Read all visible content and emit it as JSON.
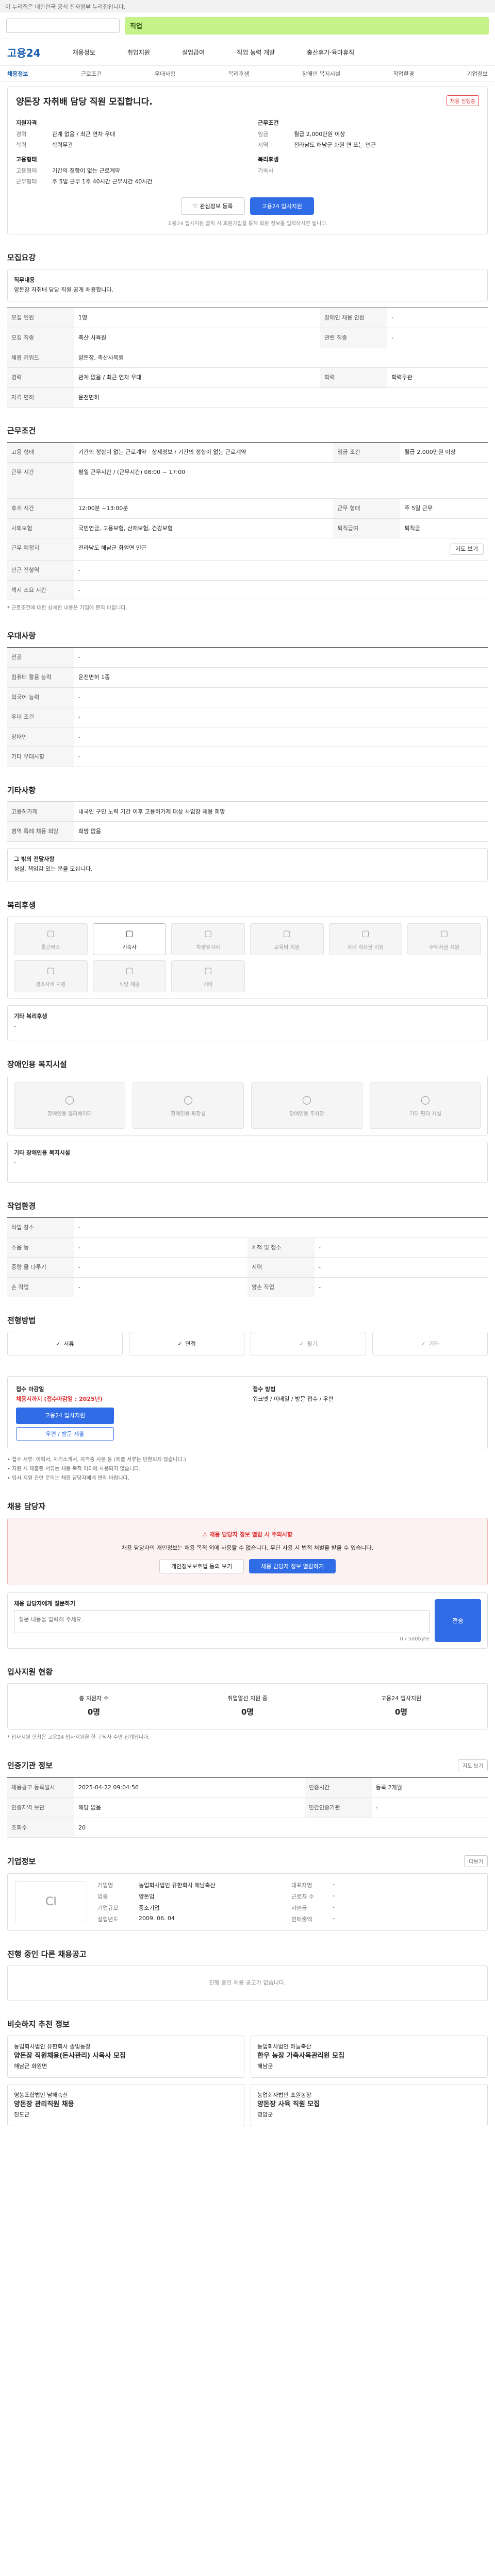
{
  "topbar": "이 누리집은 대한민국 공식 전자정부 누리집입니다.",
  "banner": "직업",
  "logo": "고용24",
  "gnb": [
    "채용정보",
    "취업지원",
    "실업급여",
    "직업 능력 개발",
    "출산휴가·육아휴직"
  ],
  "tabs": [
    "채용정보",
    "근로조건",
    "우대사항",
    "복리후생",
    "장애인 복지시설",
    "작업환경",
    "기업정보"
  ],
  "job": {
    "title": "양돈장 자취배 담당 직원 모집합니다.",
    "status": "채용 진행중",
    "left_head": "지원자격",
    "left": [
      [
        "경력",
        "관계 없음 / 최근 연차 우대"
      ],
      [
        "학력",
        "학력무관"
      ]
    ],
    "right_head": "근무조건",
    "right": [
      [
        "임금",
        "월급 2,000만원 이상"
      ],
      [
        "지역",
        "전라남도 해남군 화원 면 또는 인근"
      ]
    ],
    "left2_head": "고용형태",
    "left2": [
      [
        "고용형태",
        "기간의 정함이 없는 근로계약"
      ],
      [
        "근무형태",
        "주 5일 근무 1주 40시간 근무시간 40시간"
      ]
    ],
    "right2_head": "복리후생",
    "right2": [
      [
        "기숙사",
        "기숙사"
      ]
    ],
    "btn_save": "관심정보 등록",
    "btn_apply": "고용24 입사지원",
    "note": "고용24 입사지원 클릭 시 회원가입을 통해 회원 정보를 입력하시면 됩니다."
  },
  "recruit": {
    "heading": "모집요강",
    "task_head": "직무내용",
    "task": "양돈장 자취배 담당 직원 공개 채용합니다.",
    "rows": [
      [
        "모집 인원",
        "1명",
        "장애인 채용 인원",
        "-"
      ],
      [
        "모집 직종",
        "축산 사육원",
        "관련 직종",
        "-"
      ],
      [
        "채용 키워드",
        "양돈장, 축산사육원",
        "",
        ""
      ],
      [
        "경력",
        "관계 없음 / 최근 연차 우대",
        "학력",
        "학력무관"
      ],
      [
        "자격 면허",
        "운전면허",
        "",
        ""
      ]
    ]
  },
  "conditions": {
    "heading": "근무조건",
    "rows": [
      [
        "고용 형태",
        "기간의 정함이 없는 근로계약 · 상세정보 / 기간의 정함이 없는 근로계약",
        "임금 조건",
        "월급 2,000만원 이상"
      ],
      [
        "근무 시간",
        "평일 근무시간 / (근무시간) 08:00 ~ 17:00",
        "",
        ""
      ],
      [
        "휴게 시간",
        "12:00분 ~13:00분",
        "근무 형태",
        "주 5일 근무"
      ],
      [
        "사회보험",
        "국민연금, 고용보험, 산재보험, 건강보험",
        "퇴직급여",
        "퇴직금"
      ],
      [
        "근무 예정지",
        "전라남도 해남군 화원면 인근",
        "",
        ""
      ],
      [
        "인근 전철역",
        "-",
        "",
        ""
      ],
      [
        "택시 소요 시간",
        "-",
        "",
        ""
      ]
    ],
    "map_btn": "지도 보기",
    "foot": "* 근로조건에 대한 상세한 내용은 기업에 문의 바랍니다."
  },
  "preference": {
    "heading": "우대사항",
    "rows": [
      [
        "전공",
        "-"
      ],
      [
        "컴퓨터 활용 능력",
        "운전면허 1종"
      ],
      [
        "외국어 능력",
        "-"
      ],
      [
        "우대 조건",
        "-"
      ],
      [
        "장애인",
        "-"
      ],
      [
        "기타 우대사항",
        "-"
      ]
    ]
  },
  "other": {
    "heading": "기타사항",
    "rows": [
      [
        "고용허가제",
        "내국인 구인 노력 기간 이후 고용허가제 대상 사업장 채용 희망"
      ],
      [
        "병역 특례 채용 희망",
        "희망 없음"
      ]
    ],
    "etc_head": "그 밖의 전달사항",
    "etc": "성실, 책임감 있는 분을 모십니다."
  },
  "benefits": {
    "heading": "복리후생",
    "items": [
      "통근버스",
      "기숙사",
      "차량유지비",
      "교육비 지원",
      "자녀 학자금 지원",
      "주택자금 지원",
      "경조사비 지원",
      "식당 제공",
      "기타"
    ],
    "active": 1,
    "other_head": "기타 복리후생",
    "other": "-"
  },
  "disabled": {
    "heading": "장애인용 복지시설",
    "items": [
      "장애인용 엘리베이터",
      "장애인용 화장실",
      "장애인용 주차장",
      "기타 편의 시설"
    ],
    "other_head": "기타 장애인용 복지시설",
    "other": "-"
  },
  "environment": {
    "heading": "작업환경",
    "rows": [
      [
        "작업 장소",
        "-",
        "",
        ""
      ],
      [
        "소음 등",
        "-",
        "세척 및 청소",
        "-"
      ],
      [
        "중량 물 다루기",
        "-",
        "시력",
        "-"
      ],
      [
        "손 작업",
        "-",
        "양손 작업",
        "-"
      ]
    ]
  },
  "method": {
    "heading": "전형방법",
    "items": [
      "서류",
      "면접",
      "필기",
      "기타"
    ],
    "active": [
      0,
      1
    ]
  },
  "apply": {
    "title1": "접수 마감일",
    "deadline": "채용시까지 (접수마감일 : 2025년)",
    "btn_apply": "고용24 입사지원",
    "btn_paper": "우편 / 방문 제출",
    "title2": "접수 방법",
    "methods": "워크넷 / 이메일 / 방문 접수 / 우편",
    "bullets": [
      "접수 서류: 이력서, 자기소개서, 자격증 사본 등 (제출 서류는 반환되지 않습니다.)",
      "지원 시 제출된 서류는 채용 목적 이외에 사용되지 않습니다.",
      "입사 지원 관련 문의는 채용 담당자에게 연락 바랍니다."
    ]
  },
  "manager": {
    "heading": "채용 담당자",
    "notice_title": "채용 담당자 정보 열람 시 주의사항",
    "notice_body": "채용 담당자의 개인정보는 채용 목적 외에 사용할 수 없습니다. 무단 사용 시 법적 처벌을 받을 수 있습니다.",
    "btn_agree": "개인정보보호법 동의 보기",
    "btn_view": "채용 담당자 정보 열람하기",
    "qna_label": "채용 담당자에게 질문하기",
    "qna_placeholder": "질문 내용을 입력해 주세요.",
    "qna_btn": "전송",
    "count": "0 / 500byte"
  },
  "applicants": {
    "heading": "입사지원 현황",
    "items": [
      [
        "총 지원자 수",
        "0명"
      ],
      [
        "취업알선 지원 중",
        "0명"
      ],
      [
        "고용24 입사지원",
        "0명"
      ]
    ],
    "note": "* 입사지원 현황은 고용24 입사지원을 한 구직자 수만 집계됩니다."
  },
  "info": {
    "heading": "인증기관 정보",
    "rows": [
      [
        "채용공고 등록일시",
        "2025-04-22 09:04:56",
        "인증시간",
        "등록 2개월"
      ],
      [
        "인증지역 보관",
        "해당 없음",
        "민간인증기관",
        "-"
      ],
      [
        "조회수",
        "20",
        "",
        ""
      ]
    ],
    "btn": "지도 보기"
  },
  "company": {
    "heading": "기업정보",
    "more": "더보기",
    "logo": "CI",
    "rows": [
      [
        "기업명",
        "농업회사법인 유한회사 해남축산",
        "대표자명",
        "-"
      ],
      [
        "업종",
        "양돈업",
        "근로자 수",
        "-"
      ],
      [
        "기업규모",
        "중소기업",
        "자본금",
        "-"
      ],
      [
        "설립년도",
        "2009. 06. 04",
        "연매출액",
        "-"
      ]
    ]
  },
  "same_co": {
    "heading": "진행 중인 다른 채용공고",
    "body": "진행 중인 채용 공고가 없습니다."
  },
  "recommend": {
    "heading": "비슷하지 추천 정보",
    "items": [
      [
        "농업회사법인 유한회사 솔빛농장",
        "양돈장 직원채용(돈사관리) 사육사 모집",
        "해남군 화원면"
      ],
      [
        "농업회사법인 하늘축산",
        "한우 농장 가축사육관리원 모집",
        "해남군"
      ],
      [
        "영농조합법인 남해축산",
        "양돈장 관리직원 채용",
        "진도군"
      ],
      [
        "농업회사법인 초원농장",
        "양돈장 사육 직원 모집",
        "영암군"
      ]
    ]
  }
}
